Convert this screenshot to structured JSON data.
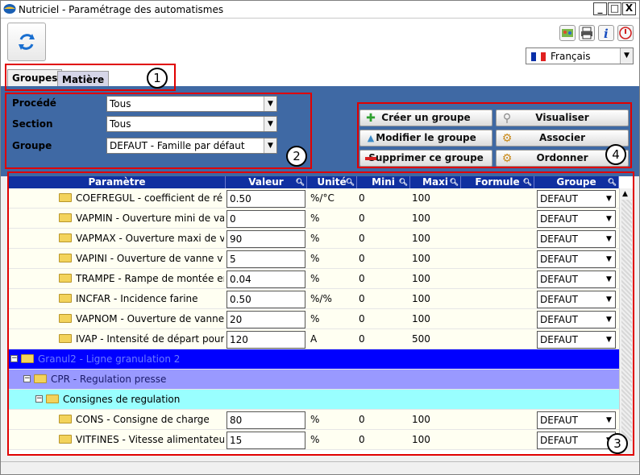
{
  "window": {
    "title": "Nutriciel - Paramétrage des automatismes",
    "minimize": "_",
    "maximize": "□",
    "close": "X"
  },
  "toolbar": {
    "refresh_icon": "refresh-icon",
    "icons": [
      "palette-icon",
      "printer-icon",
      "info-icon",
      "power-icon"
    ],
    "language": "Français",
    "flag_colors": [
      "#0a2fa8",
      "#ffffff",
      "#e02020"
    ]
  },
  "tabs": [
    {
      "label": "Groupes"
    },
    {
      "label": "Matière"
    }
  ],
  "filters": {
    "procede_label": "Procédé",
    "procede_value": "Tous",
    "section_label": "Section",
    "section_value": "Tous",
    "groupe_label": "Groupe",
    "groupe_value": "DEFAUT - Famille par défaut"
  },
  "actions": {
    "create": "Créer un groupe",
    "modify": "Modifier le groupe",
    "delete": "Supprimer ce groupe",
    "view": "Visualiser",
    "associate": "Associer",
    "order": "Ordonner"
  },
  "annotations": [
    "1",
    "2",
    "3",
    "4"
  ],
  "grid": {
    "columns": [
      "Paramètre",
      "Valeur",
      "Unité",
      "Mini",
      "Maxi",
      "Formule",
      "Groupe"
    ],
    "rows": [
      {
        "param": "COEFREGUL - coefficient de ré",
        "valeur": "0.50",
        "unite": "%/°C",
        "mini": "0",
        "maxi": "100",
        "groupe": "DEFAUT"
      },
      {
        "param": "VAPMIN - Ouverture mini de va",
        "valeur": "0",
        "unite": "%",
        "mini": "0",
        "maxi": "100",
        "groupe": "DEFAUT"
      },
      {
        "param": "VAPMAX - Ouverture maxi de v",
        "valeur": "90",
        "unite": "%",
        "mini": "0",
        "maxi": "100",
        "groupe": "DEFAUT"
      },
      {
        "param": "VAPINI - Ouverture de vanne v",
        "valeur": "5",
        "unite": "%",
        "mini": "0",
        "maxi": "100",
        "groupe": "DEFAUT"
      },
      {
        "param": "TRAMPE - Rampe de montée er",
        "valeur": "0.04",
        "unite": "%",
        "mini": "0",
        "maxi": "100",
        "groupe": "DEFAUT"
      },
      {
        "param": "INCFAR - Incidence farine",
        "valeur": "0.50",
        "unite": "%/%",
        "mini": "0",
        "maxi": "100",
        "groupe": "DEFAUT"
      },
      {
        "param": "VAPNOM - Ouverture de vanne",
        "valeur": "20",
        "unite": "%",
        "mini": "0",
        "maxi": "100",
        "groupe": "DEFAUT"
      },
      {
        "param": "IVAP - Intensité de départ pour",
        "valeur": "120",
        "unite": "A",
        "mini": "0",
        "maxi": "500",
        "groupe": "DEFAUT"
      }
    ],
    "tree": {
      "level1": "Granul2 - Ligne granulation 2",
      "level2": "CPR - Regulation presse",
      "level3": "Consignes de regulation"
    },
    "rows2": [
      {
        "param": "CONS - Consigne de charge",
        "valeur": "80",
        "unite": "%",
        "mini": "0",
        "maxi": "100",
        "groupe": "DEFAUT"
      },
      {
        "param": "VITFINES - Vitesse alimentateu",
        "valeur": "15",
        "unite": "%",
        "mini": "0",
        "maxi": "100",
        "groupe": "DEFAUT"
      }
    ]
  }
}
